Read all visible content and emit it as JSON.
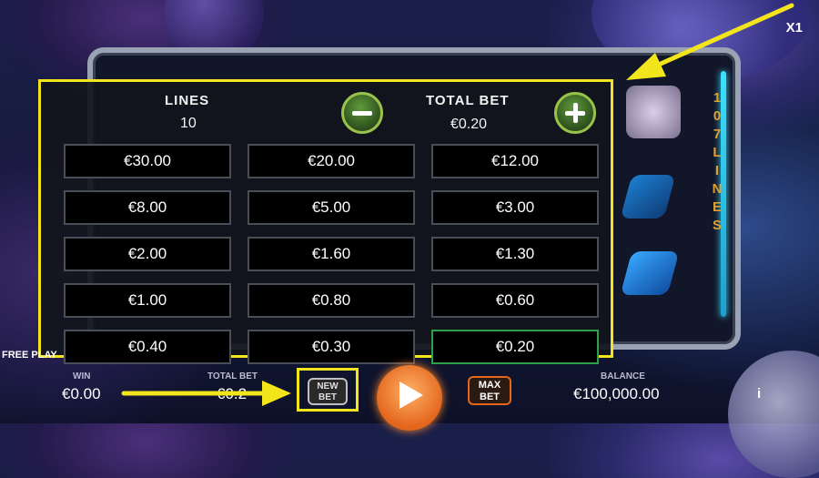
{
  "game": {
    "multiplier_label": "X1",
    "side_word": [
      "1",
      "0",
      "7",
      "L",
      "I",
      "N",
      "E",
      "S"
    ],
    "free_play_label": "FREE PLAY"
  },
  "bet_panel": {
    "lines_label": "LINES",
    "lines_value": "10",
    "total_bet_label": "TOTAL BET",
    "total_bet_value": "€0.20",
    "decrease_icon": "minus-icon",
    "increase_icon": "plus-icon",
    "options": [
      [
        "€30.00",
        "€20.00",
        "€12.00"
      ],
      [
        "€8.00",
        "€5.00",
        "€3.00"
      ],
      [
        "€2.00",
        "€1.60",
        "€1.30"
      ],
      [
        "€1.00",
        "€0.80",
        "€0.60"
      ],
      [
        "€0.40",
        "€0.30",
        "€0.20"
      ]
    ],
    "selected": "€0.20"
  },
  "bottom_bar": {
    "win_label": "WIN",
    "win_value": "€0.00",
    "total_bet_label": "TOTAL BET",
    "total_bet_value": "€0.2",
    "new_bet_label": "NEW",
    "new_bet_label2": "BET",
    "max_bet_label": "MAX",
    "max_bet_label2": "BET",
    "balance_label": "BALANCE",
    "balance_value": "€100,000.00",
    "info_label": "i"
  },
  "colors": {
    "highlight": "#f2e51c",
    "selected_border": "#2fa04a",
    "spin": "#e3661c"
  }
}
